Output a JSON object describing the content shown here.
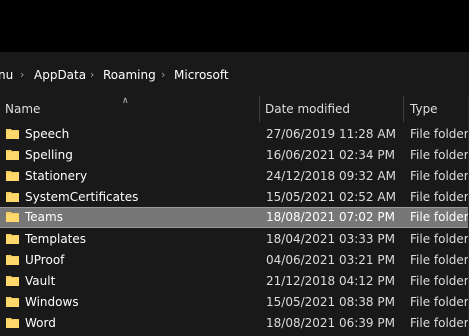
{
  "breadcrumb": {
    "items": [
      {
        "label": "nu"
      },
      {
        "label": "AppData"
      },
      {
        "label": "Roaming"
      },
      {
        "label": "Microsoft"
      }
    ],
    "separator_icon": "chevron-right-icon"
  },
  "columns": {
    "name": "Name",
    "date_modified": "Date modified",
    "type": "Type",
    "sort_icon": "sort-up-arrow-icon"
  },
  "colors": {
    "background": "#191919",
    "titlebar": "#000000",
    "selected_row": "#777777",
    "folder_icon": "#f5cf5d"
  },
  "files": [
    {
      "name": "Speech",
      "date": "27/06/2019 11:28 AM",
      "type": "File folder",
      "selected": false
    },
    {
      "name": "Spelling",
      "date": "16/06/2021 02:34 PM",
      "type": "File folder",
      "selected": false
    },
    {
      "name": "Stationery",
      "date": "24/12/2018 09:32 AM",
      "type": "File folder",
      "selected": false
    },
    {
      "name": "SystemCertificates",
      "date": "15/05/2021 02:52 AM",
      "type": "File folder",
      "selected": false
    },
    {
      "name": "Teams",
      "date": "18/08/2021 07:02 PM",
      "type": "File folder",
      "selected": true
    },
    {
      "name": "Templates",
      "date": "18/04/2021 03:33 PM",
      "type": "File folder",
      "selected": false
    },
    {
      "name": "UProof",
      "date": "04/06/2021 03:21 PM",
      "type": "File folder",
      "selected": false
    },
    {
      "name": "Vault",
      "date": "21/12/2018 04:12 PM",
      "type": "File folder",
      "selected": false
    },
    {
      "name": "Windows",
      "date": "15/05/2021 08:38 PM",
      "type": "File folder",
      "selected": false
    },
    {
      "name": "Word",
      "date": "18/08/2021 06:39 PM",
      "type": "File folder",
      "selected": false
    }
  ]
}
